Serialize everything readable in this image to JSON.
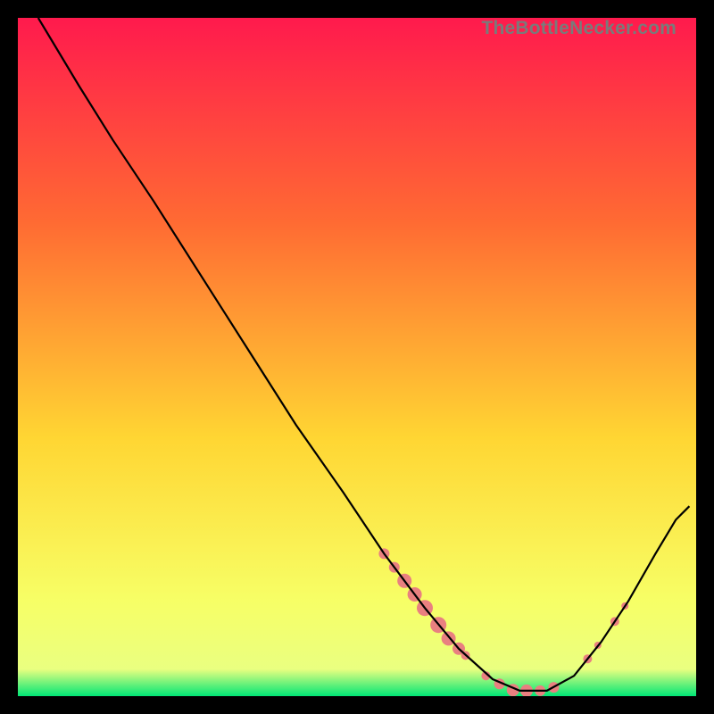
{
  "watermark": "TheBottleNecker.com",
  "chart_data": {
    "type": "line",
    "title": "",
    "xlabel": "",
    "ylabel": "",
    "xlim": [
      0,
      100
    ],
    "ylim": [
      0,
      100
    ],
    "background_gradient": {
      "top": "#ff1a4d",
      "mid": "#ffd633",
      "bottom": "#00e676"
    },
    "series": [
      {
        "name": "curve",
        "color": "#000000",
        "points": [
          {
            "x": 3,
            "y": 100
          },
          {
            "x": 6,
            "y": 95
          },
          {
            "x": 9,
            "y": 90
          },
          {
            "x": 14,
            "y": 82
          },
          {
            "x": 20,
            "y": 73
          },
          {
            "x": 27,
            "y": 62
          },
          {
            "x": 34,
            "y": 51
          },
          {
            "x": 41,
            "y": 40
          },
          {
            "x": 48,
            "y": 30
          },
          {
            "x": 54,
            "y": 21
          },
          {
            "x": 60,
            "y": 13
          },
          {
            "x": 65,
            "y": 7
          },
          {
            "x": 70,
            "y": 2.5
          },
          {
            "x": 74,
            "y": 0.8
          },
          {
            "x": 78,
            "y": 0.8
          },
          {
            "x": 82,
            "y": 3
          },
          {
            "x": 86,
            "y": 8
          },
          {
            "x": 90,
            "y": 14
          },
          {
            "x": 94,
            "y": 21
          },
          {
            "x": 97,
            "y": 26
          },
          {
            "x": 99,
            "y": 28
          }
        ]
      }
    ],
    "markers": {
      "color": "#e98080",
      "points": [
        {
          "x": 54,
          "y": 21,
          "r": 6
        },
        {
          "x": 55.5,
          "y": 19,
          "r": 6
        },
        {
          "x": 57,
          "y": 17,
          "r": 8
        },
        {
          "x": 58.5,
          "y": 15,
          "r": 8
        },
        {
          "x": 60,
          "y": 13,
          "r": 9
        },
        {
          "x": 62,
          "y": 10.5,
          "r": 9
        },
        {
          "x": 63.5,
          "y": 8.5,
          "r": 8
        },
        {
          "x": 65,
          "y": 7,
          "r": 7
        },
        {
          "x": 66,
          "y": 6,
          "r": 5
        },
        {
          "x": 69,
          "y": 3,
          "r": 5
        },
        {
          "x": 71,
          "y": 1.8,
          "r": 6
        },
        {
          "x": 73,
          "y": 0.9,
          "r": 7
        },
        {
          "x": 75,
          "y": 0.8,
          "r": 7
        },
        {
          "x": 77,
          "y": 0.8,
          "r": 6
        },
        {
          "x": 79,
          "y": 1.3,
          "r": 6
        },
        {
          "x": 84,
          "y": 5.5,
          "r": 5
        },
        {
          "x": 85.5,
          "y": 7.5,
          "r": 4
        },
        {
          "x": 88,
          "y": 11,
          "r": 5
        },
        {
          "x": 89.5,
          "y": 13.3,
          "r": 4
        }
      ]
    }
  }
}
